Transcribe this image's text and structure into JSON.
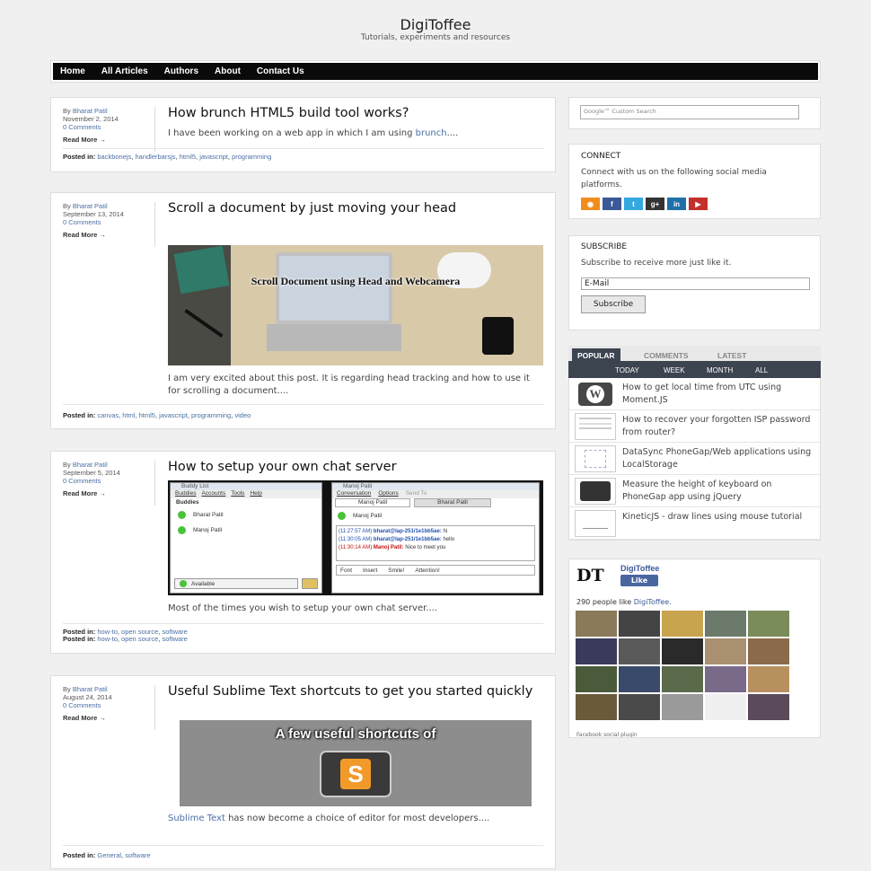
{
  "site": {
    "title": "DigiToffee",
    "tagline": "Tutorials, experiments and resources"
  },
  "nav": [
    "Home",
    "All Articles",
    "Authors",
    "About",
    "Contact Us"
  ],
  "posts": [
    {
      "by": "By",
      "author": "Bharat Patil",
      "date": "November 2, 2014",
      "comments": "0 Comments",
      "read_more": "Read More →",
      "title": "How brunch HTML5 build tool works?",
      "excerpt_pre": "I have been working on a web app in which I am using ",
      "excerpt_link": "brunch",
      "excerpt_post": "....",
      "posted_in": "Posted in:",
      "tags": [
        "backbonejs",
        "handlerbarsjs",
        "html5",
        "javascript",
        "programming"
      ]
    },
    {
      "by": "By",
      "author": "Bharat Patil",
      "date": "September 13, 2014",
      "comments": "0 Comments",
      "read_more": "Read More →",
      "title": "Scroll a document by just moving your head",
      "image_caption": "Scroll Document using Head and Webcamera",
      "excerpt": "I am very excited about this post. It is regarding head tracking and how to use it for scrolling a document....",
      "posted_in": "Posted in:",
      "tags": [
        "canvas",
        "html",
        "html5",
        "javascript",
        "programming",
        "video"
      ]
    },
    {
      "by": "By",
      "author": "Bharat Patil",
      "date": "September 5, 2014",
      "comments": "0 Comments",
      "read_more": "Read More →",
      "title": "How to setup your own chat server",
      "chat": {
        "buddy_list_title": "Buddy List",
        "menus": [
          "Buddies",
          "Accounts",
          "Tools",
          "Help"
        ],
        "group": "Buddies",
        "buddies": [
          "Bharat Patil",
          "Manoj Patil"
        ],
        "status": "Available",
        "window_title": "Manoj Patil",
        "conv_menus": [
          "Conversation",
          "Options",
          "Send To"
        ],
        "tabs": [
          "Manoj Patil",
          "Bharat Patil"
        ],
        "contact": "Manoj Patil",
        "messages": [
          {
            "time": "(11:27:57 AM)",
            "who": "bharat@lap-251/1e1bb5ae:",
            "text": "hi"
          },
          {
            "time": "(11:30:05 AM)",
            "who": "bharat@lap-251/1e1bb5ae:",
            "text": "hello"
          },
          {
            "time": "(11:30:14 AM)",
            "who": "Manoj Patil:",
            "text": "Nice to meet you"
          }
        ],
        "toolbar": [
          "Font",
          "Insert",
          "Smile!",
          "Attention!"
        ]
      },
      "excerpt": "Most of the times you wish to setup your own chat server....",
      "posted_in": "Posted in:",
      "tags": [
        "how-to",
        "open source",
        "software"
      ]
    },
    {
      "by": "By",
      "author": "Bharat Patil",
      "date": "August 24, 2014",
      "comments": "0 Comments",
      "read_more": "Read More →",
      "title": "Useful Sublime Text shortcuts to get you started quickly",
      "image_caption": "A few useful shortcuts of",
      "excerpt_link": "Sublime Text",
      "excerpt_post": " has now become a choice of editor for most developers....",
      "posted_in": "Posted in:",
      "tags": [
        "General",
        "software"
      ]
    }
  ],
  "sidebar": {
    "search_placeholder": "Google™ Custom Search",
    "connect": {
      "title": "CONNECT",
      "text": "Connect with us on the following social media platforms.",
      "icons": [
        "rss-icon",
        "facebook-icon",
        "twitter-icon",
        "googleplus-icon",
        "linkedin-icon",
        "youtube-icon"
      ]
    },
    "subscribe": {
      "title": "SUBSCRIBE",
      "text": "Subscribe to receive more just like it.",
      "email_value": "E-Mail",
      "button": "Subscribe"
    },
    "tabs": {
      "main": [
        "POPULAR",
        "COMMENTS",
        "LATEST"
      ],
      "sub": [
        "TODAY",
        "WEEK",
        "MONTH",
        "ALL"
      ]
    },
    "popular": [
      "How to get local time from UTC using Moment.JS",
      "How to recover your forgotten ISP password from router?",
      "DataSync PhoneGap/Web applications using LocalStorage",
      "Measure the height of keyboard on PhoneGap app using jQuery",
      "KineticJS - draw lines using mouse tutorial"
    ],
    "facebook": {
      "logo": "DT",
      "name": "DigiToffee",
      "like": "Like",
      "count": "290 people like ",
      "count_link": "DigiToffee.",
      "plugin": "Facebook social plugin"
    }
  },
  "colors": {
    "nav_bg": "#0a0a0a",
    "link": "#4a6fa5",
    "tab_bg": "#3c4450",
    "fb_blue": "#3b5998"
  }
}
